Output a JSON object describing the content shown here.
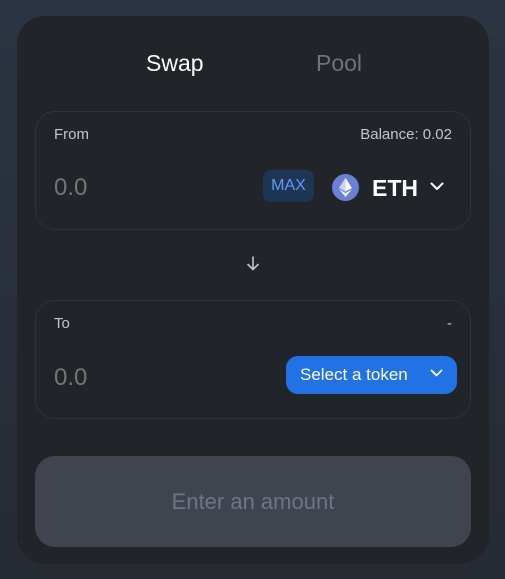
{
  "tabs": [
    {
      "label": "Swap",
      "active": true
    },
    {
      "label": "Pool",
      "active": false
    }
  ],
  "from": {
    "label": "From",
    "balance": "Balance: 0.02",
    "amount_placeholder": "0.0",
    "max_label": "MAX",
    "token": {
      "symbol": "ETH",
      "icon": "ethereum-icon"
    }
  },
  "to": {
    "label": "To",
    "balance": "-",
    "amount_placeholder": "0.0",
    "select_label": "Select a token"
  },
  "submit": {
    "label": "Enter an amount",
    "disabled": true
  },
  "colors": {
    "accent": "#2172e5",
    "card_bg": "#212429",
    "max_bg": "#1e3555",
    "max_text": "#5c9cf5",
    "disabled_bg": "#40444f"
  }
}
